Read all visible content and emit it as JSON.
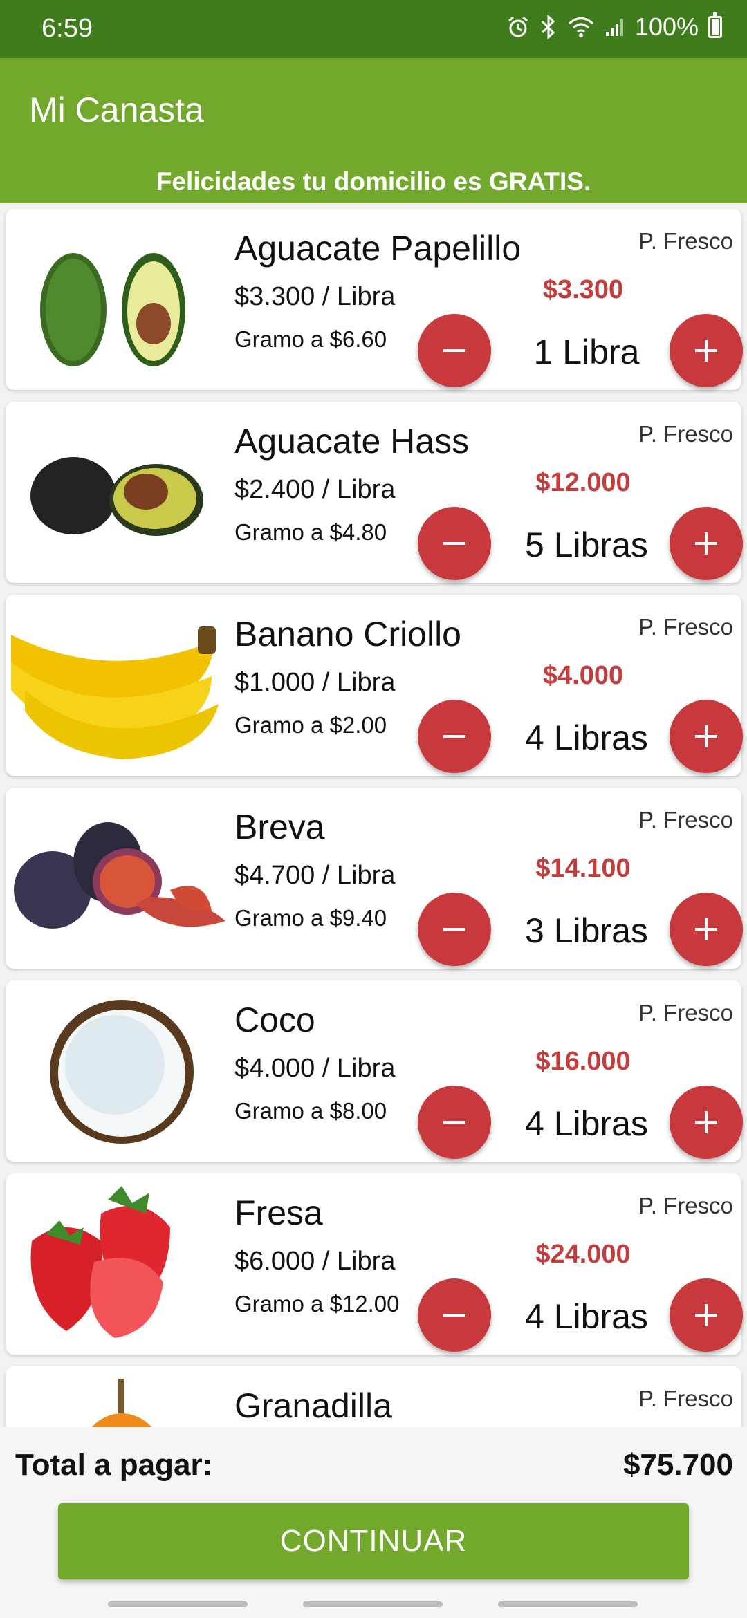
{
  "status_bar": {
    "time": "6:59",
    "battery": "100%",
    "icons": [
      "alarm-icon",
      "bluetooth-icon",
      "wifi-icon",
      "signal-icon",
      "battery-icon"
    ]
  },
  "app_bar": {
    "title": "Mi Canasta"
  },
  "banner": {
    "text": "Felicidades tu domicilio es GRATIS."
  },
  "products": [
    {
      "name": "Aguacate Papelillo",
      "unit_price": "$3.300 / Libra",
      "gram_price": "Gramo a $6.60",
      "tag": "P. Fresco",
      "total": "$3.300",
      "quantity": "1 Libra",
      "image": "avocado-papelillo"
    },
    {
      "name": "Aguacate Hass",
      "unit_price": "$2.400 / Libra",
      "gram_price": "Gramo a $4.80",
      "tag": "P. Fresco",
      "total": "$12.000",
      "quantity": "5 Libras",
      "image": "avocado-hass"
    },
    {
      "name": "Banano Criollo",
      "unit_price": "$1.000 / Libra",
      "gram_price": "Gramo a $2.00",
      "tag": "P. Fresco",
      "total": "$4.000",
      "quantity": "4 Libras",
      "image": "banana"
    },
    {
      "name": "Breva",
      "unit_price": "$4.700 / Libra",
      "gram_price": "Gramo a $9.40",
      "tag": "P. Fresco",
      "total": "$14.100",
      "quantity": "3 Libras",
      "image": "fig"
    },
    {
      "name": "Coco",
      "unit_price": "$4.000 / Libra",
      "gram_price": "Gramo a $8.00",
      "tag": "P. Fresco",
      "total": "$16.000",
      "quantity": "4 Libras",
      "image": "coconut"
    },
    {
      "name": "Fresa",
      "unit_price": "$6.000 / Libra",
      "gram_price": "Gramo a $12.00",
      "tag": "P. Fresco",
      "total": "$24.000",
      "quantity": "4 Libras",
      "image": "strawberry"
    },
    {
      "name": "Granadilla",
      "tag": "P. Fresco",
      "image": "granadilla"
    }
  ],
  "footer": {
    "total_label": "Total a pagar:",
    "total_value": "$75.700",
    "continue_label": "CONTINUAR"
  },
  "colors": {
    "status_bar": "#3f7d1c",
    "primary": "#72a92d",
    "accent_red": "#c8393d",
    "price_red": "#c43d3d"
  }
}
